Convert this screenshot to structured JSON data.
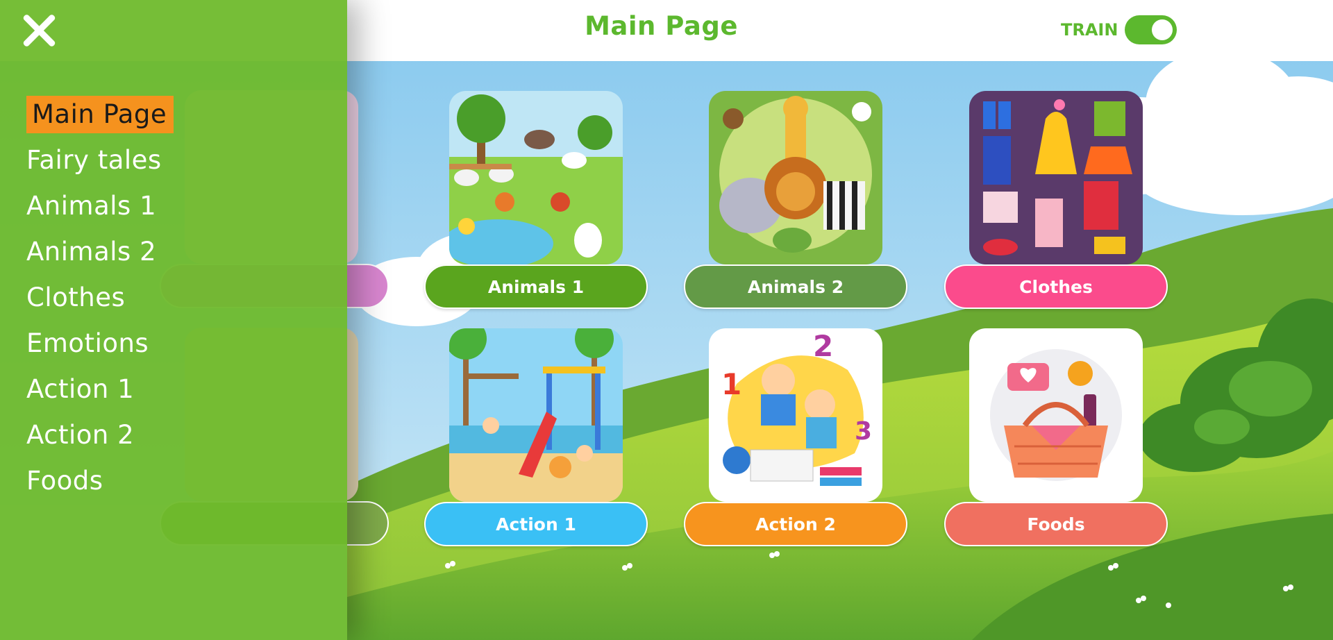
{
  "header": {
    "title": "Main Page",
    "train_label": "TRAIN",
    "train_on": true
  },
  "drawer": {
    "items": [
      {
        "label": "Main Page",
        "active": true
      },
      {
        "label": "Fairy tales",
        "active": false
      },
      {
        "label": "Animals 1",
        "active": false
      },
      {
        "label": "Animals 2",
        "active": false
      },
      {
        "label": "Clothes",
        "active": false
      },
      {
        "label": "Emotions",
        "active": false
      },
      {
        "label": "Action 1",
        "active": false
      },
      {
        "label": "Action 2",
        "active": false
      },
      {
        "label": "Foods",
        "active": false
      }
    ]
  },
  "cards": [
    {
      "label": "Animals 1",
      "color": "#5aa51e",
      "image": "farm-animals-picture"
    },
    {
      "label": "Animals 2",
      "color": "#639a47",
      "image": "jungle-animals-picture"
    },
    {
      "label": "Clothes",
      "color": "#fb4b8c",
      "image": "clothes-picture"
    },
    {
      "label": "Action 1",
      "color": "#3ac0f5",
      "image": "playground-picture"
    },
    {
      "label": "Action 2",
      "color": "#f7941e",
      "image": "kids-reading-picture"
    },
    {
      "label": "Foods",
      "color": "#f07060",
      "image": "picnic-basket-picture"
    }
  ],
  "colors": {
    "accent": "#5cb82e",
    "drawer": "#6dba2b",
    "active_highlight": "#f5921e"
  }
}
